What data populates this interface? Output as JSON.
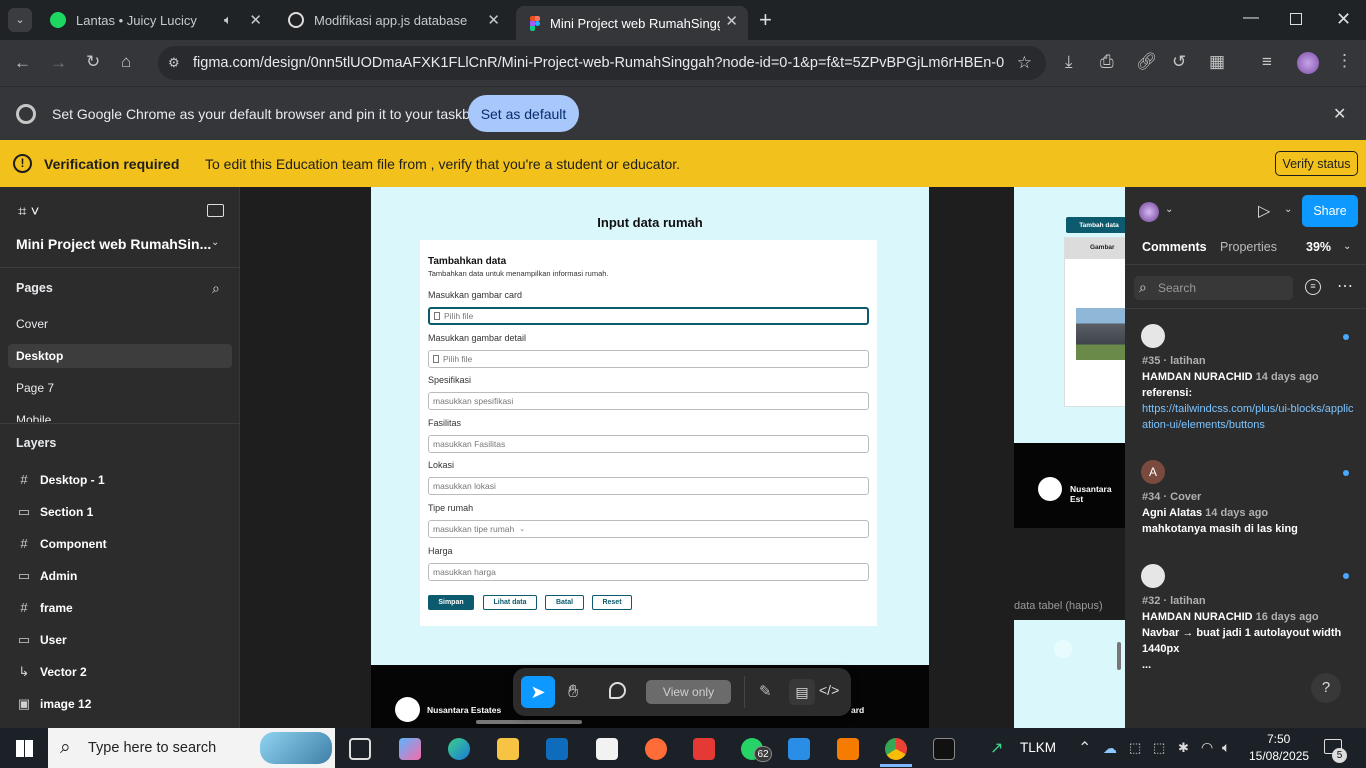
{
  "browser": {
    "tabs": [
      {
        "title": "Lantas • Juicy Lucicy",
        "icon": "spotify-icon",
        "audio": true
      },
      {
        "title": "Modifikasi app.js database",
        "icon": "chatgpt-icon"
      },
      {
        "title": "Mini Project web RumahSinggah",
        "icon": "figma-icon",
        "active": true
      }
    ],
    "new_tab": "+",
    "url": "figma.com/design/0nn5tlUODmaAFXK1FLlCnR/Mini-Project-web-RumahSinggah?node-id=0-1&p=f&t=5ZPvBPGjLm6rHBEn-0",
    "infobar_text": "Set Google Chrome as your default browser and pin it to your taskbar",
    "infobar_button": "Set as default"
  },
  "verification": {
    "title": "Verification required",
    "message": "To edit this Education team file from , verify that you're a student or educator.",
    "button": "Verify status"
  },
  "figma_left": {
    "file_name": "Mini Project web RumahSin...",
    "pages_heading": "Pages",
    "pages": [
      "Cover",
      "Desktop",
      "Page 7",
      "Mobile"
    ],
    "active_page": "Desktop",
    "layers_heading": "Layers",
    "layers": [
      {
        "icon": "#",
        "name": "Desktop - 1"
      },
      {
        "icon": "▭",
        "name": "Section 1"
      },
      {
        "icon": "#",
        "name": "Component"
      },
      {
        "icon": "▭",
        "name": "Admin"
      },
      {
        "icon": "#",
        "name": "frame"
      },
      {
        "icon": "▭",
        "name": "User"
      },
      {
        "icon": "↳",
        "name": "Vector 2"
      },
      {
        "icon": "▣",
        "name": "image 12"
      }
    ]
  },
  "design": {
    "page_title": "Input data rumah",
    "form_title": "Tambahkan data",
    "form_subtitle": "Tambahkan data untuk menampilkan informasi rumah.",
    "fields": [
      {
        "label": "Masukkan gambar card",
        "placeholder": "Pilih file",
        "file": true,
        "focused": true
      },
      {
        "label": "Masukkan gambar detail",
        "placeholder": "Pilih file",
        "file": true
      },
      {
        "label": "Spesifikasi",
        "placeholder": "masukkan spesifikasi"
      },
      {
        "label": "Fasilitas",
        "placeholder": "masukkan Fasilitas"
      },
      {
        "label": "Lokasi",
        "placeholder": "masukkan lokasi"
      },
      {
        "label": "Tipe rumah",
        "placeholder": "masukkan tipe rumah",
        "select": true
      },
      {
        "label": "Harga",
        "placeholder": "masukkan harga"
      }
    ],
    "buttons": [
      "Simpan",
      "Lihat data",
      "Batal",
      "Reset"
    ],
    "footer_brand": "Nusantara Estates",
    "footer_right": "ard",
    "right_frame": {
      "add_button": "Tambah data",
      "column": "Gambar",
      "footer_brand": "Nusantara Est",
      "section_label": "data tabel (hapus)"
    }
  },
  "toolbar": {
    "view_only": "View only"
  },
  "figma_right": {
    "share": "Share",
    "tabs": [
      "Comments",
      "Properties"
    ],
    "zoom": "39%",
    "search_placeholder": "Search",
    "comments": [
      {
        "meta": "#35 · latihan",
        "author": "HAMDAN NURACHID",
        "time": "14 days ago",
        "text": "referensi:",
        "link": "https://tailwindcss.com/plus/ui-blocks/application-ui/elements/buttons"
      },
      {
        "initial": "A",
        "meta": "#34 · Cover",
        "author": "Agni Alatas",
        "time": "14 days ago",
        "text": "mahkotanya masih di las king"
      },
      {
        "meta": "#32 · latihan",
        "author": "HAMDAN NURACHID",
        "time": "16 days ago",
        "text": "Navbar → buat jadi 1 autolayout width 1440px",
        "more": "..."
      }
    ],
    "help": "?"
  },
  "taskbar": {
    "search_placeholder": "Type here to search",
    "whatsapp_badge": "62",
    "stock": "TLKM",
    "time": "7:50",
    "date": "15/08/2025",
    "notif": "5"
  }
}
